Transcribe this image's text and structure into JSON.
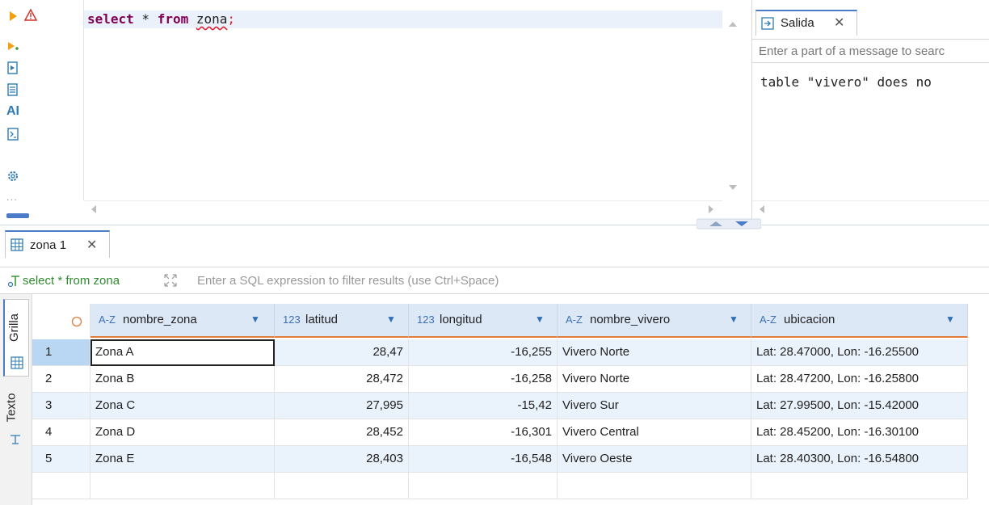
{
  "editor": {
    "sql_keyword_select": "select",
    "sql_star": " * ",
    "sql_keyword_from": "from",
    "sql_space": " ",
    "sql_table": "zona",
    "sql_semicolon": ";"
  },
  "left_toolbar": {
    "icons": [
      "execute-icon",
      "execute-new-tab-icon",
      "execute-script-icon",
      "explain-plan-icon",
      "ai-icon",
      "terminal-icon",
      "settings-icon",
      "more-icon"
    ],
    "ai_label": "AI",
    "more_label": "..."
  },
  "salida": {
    "tab_label": "Salida",
    "search_placeholder": "Enter a part of a message to searc",
    "output_line": "table \"vivero\" does no"
  },
  "results": {
    "tab_label": "zona 1",
    "query_label": "select * from zona",
    "filter_placeholder": "Enter a SQL expression to filter results (use Ctrl+Space)",
    "side_tabs": [
      "Grilla",
      "Texto"
    ],
    "columns": [
      {
        "type": "A-Z",
        "name": "nombre_zona"
      },
      {
        "type": "123",
        "name": "latitud"
      },
      {
        "type": "123",
        "name": "longitud"
      },
      {
        "type": "A-Z",
        "name": "nombre_vivero"
      },
      {
        "type": "A-Z",
        "name": "ubicacion"
      }
    ],
    "rows": [
      {
        "n": "1",
        "nombre_zona": "Zona A",
        "latitud": "28,47",
        "longitud": "-16,255",
        "nombre_vivero": "Vivero Norte",
        "ubicacion": "Lat: 28.47000, Lon: -16.25500"
      },
      {
        "n": "2",
        "nombre_zona": "Zona B",
        "latitud": "28,472",
        "longitud": "-16,258",
        "nombre_vivero": "Vivero Norte",
        "ubicacion": "Lat: 28.47200, Lon: -16.25800"
      },
      {
        "n": "3",
        "nombre_zona": "Zona C",
        "latitud": "27,995",
        "longitud": "-15,42",
        "nombre_vivero": "Vivero Sur",
        "ubicacion": "Lat: 27.99500, Lon: -15.42000"
      },
      {
        "n": "4",
        "nombre_zona": "Zona D",
        "latitud": "28,452",
        "longitud": "-16,301",
        "nombre_vivero": "Vivero Central",
        "ubicacion": "Lat: 28.45200, Lon: -16.30100"
      },
      {
        "n": "5",
        "nombre_zona": "Zona E",
        "latitud": "28,403",
        "longitud": "-16,548",
        "nombre_vivero": "Vivero Oeste",
        "ubicacion": "Lat: 28.40300, Lon: -16.54800"
      }
    ]
  },
  "colors": {
    "header_bg": "#dde8f7",
    "header_underline": "#e07b3a",
    "selected_row": "#b9d7f3",
    "alt_row": "#eaf2fb",
    "keyword": "#7f0055"
  }
}
